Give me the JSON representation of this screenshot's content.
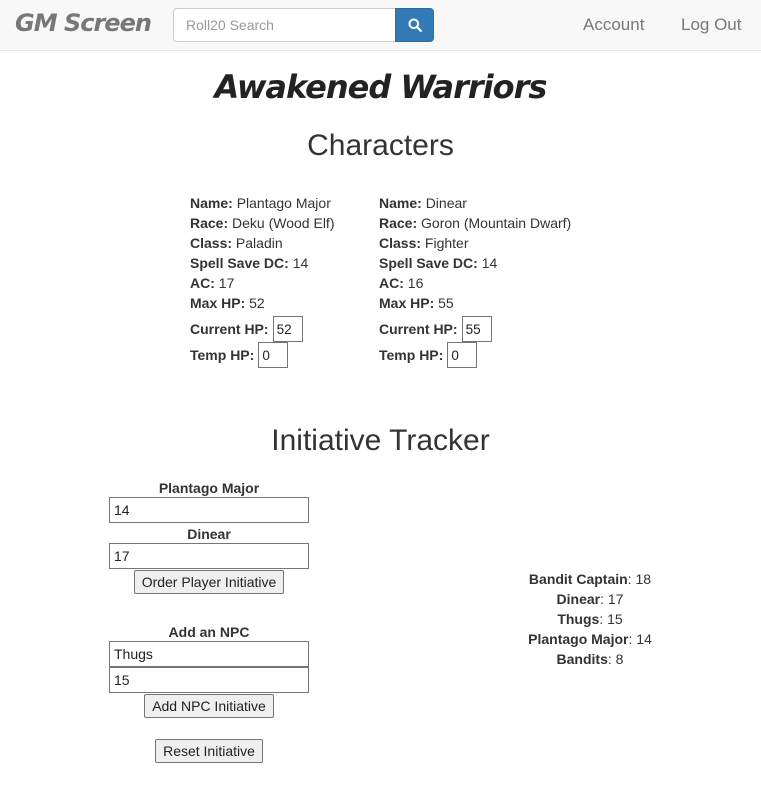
{
  "navbar": {
    "brand": "GM Screen",
    "search_placeholder": "Roll20 Search",
    "account": "Account",
    "logout": "Log Out"
  },
  "campaign_title": "Awakened Warriors",
  "characters_title": "Characters",
  "field_labels": {
    "name": "Name:",
    "race": "Race:",
    "class": "Class:",
    "spell_save_dc": "Spell Save DC:",
    "ac": "AC:",
    "max_hp": "Max HP:",
    "current_hp": "Current HP:",
    "temp_hp": "Temp HP:"
  },
  "characters": [
    {
      "name": "Plantago Major",
      "race": "Deku (Wood Elf)",
      "class": "Paladin",
      "spell_save_dc": "14",
      "ac": "17",
      "max_hp": "52",
      "current_hp": "52",
      "temp_hp": "0"
    },
    {
      "name": "Dinear",
      "race": "Goron (Mountain Dwarf)",
      "class": "Fighter",
      "spell_save_dc": "14",
      "ac": "16",
      "max_hp": "55",
      "current_hp": "55",
      "temp_hp": "0"
    }
  ],
  "initiative": {
    "title": "Initiative Tracker",
    "players": [
      {
        "name": "Plantago Major",
        "value": "14"
      },
      {
        "name": "Dinear",
        "value": "17"
      }
    ],
    "order_player_button": "Order Player Initiative",
    "add_npc_label": "Add an NPC",
    "npc_name_value": "Thugs",
    "npc_initiative_value": "15",
    "add_npc_button": "Add NPC Initiative",
    "reset_button": "Reset Initiative",
    "order": [
      {
        "name": "Bandit Captain",
        "value": ": 18"
      },
      {
        "name": "Dinear",
        "value": ": 17"
      },
      {
        "name": "Thugs",
        "value": ": 15"
      },
      {
        "name": "Plantago Major",
        "value": ": 14"
      },
      {
        "name": "Bandits",
        "value": ": 8"
      }
    ]
  },
  "colors": {
    "navbar_bg": "#f8f8f8",
    "search_button": "#337ab7",
    "nav_text": "#777777"
  },
  "icons": {
    "search": "search-icon"
  }
}
